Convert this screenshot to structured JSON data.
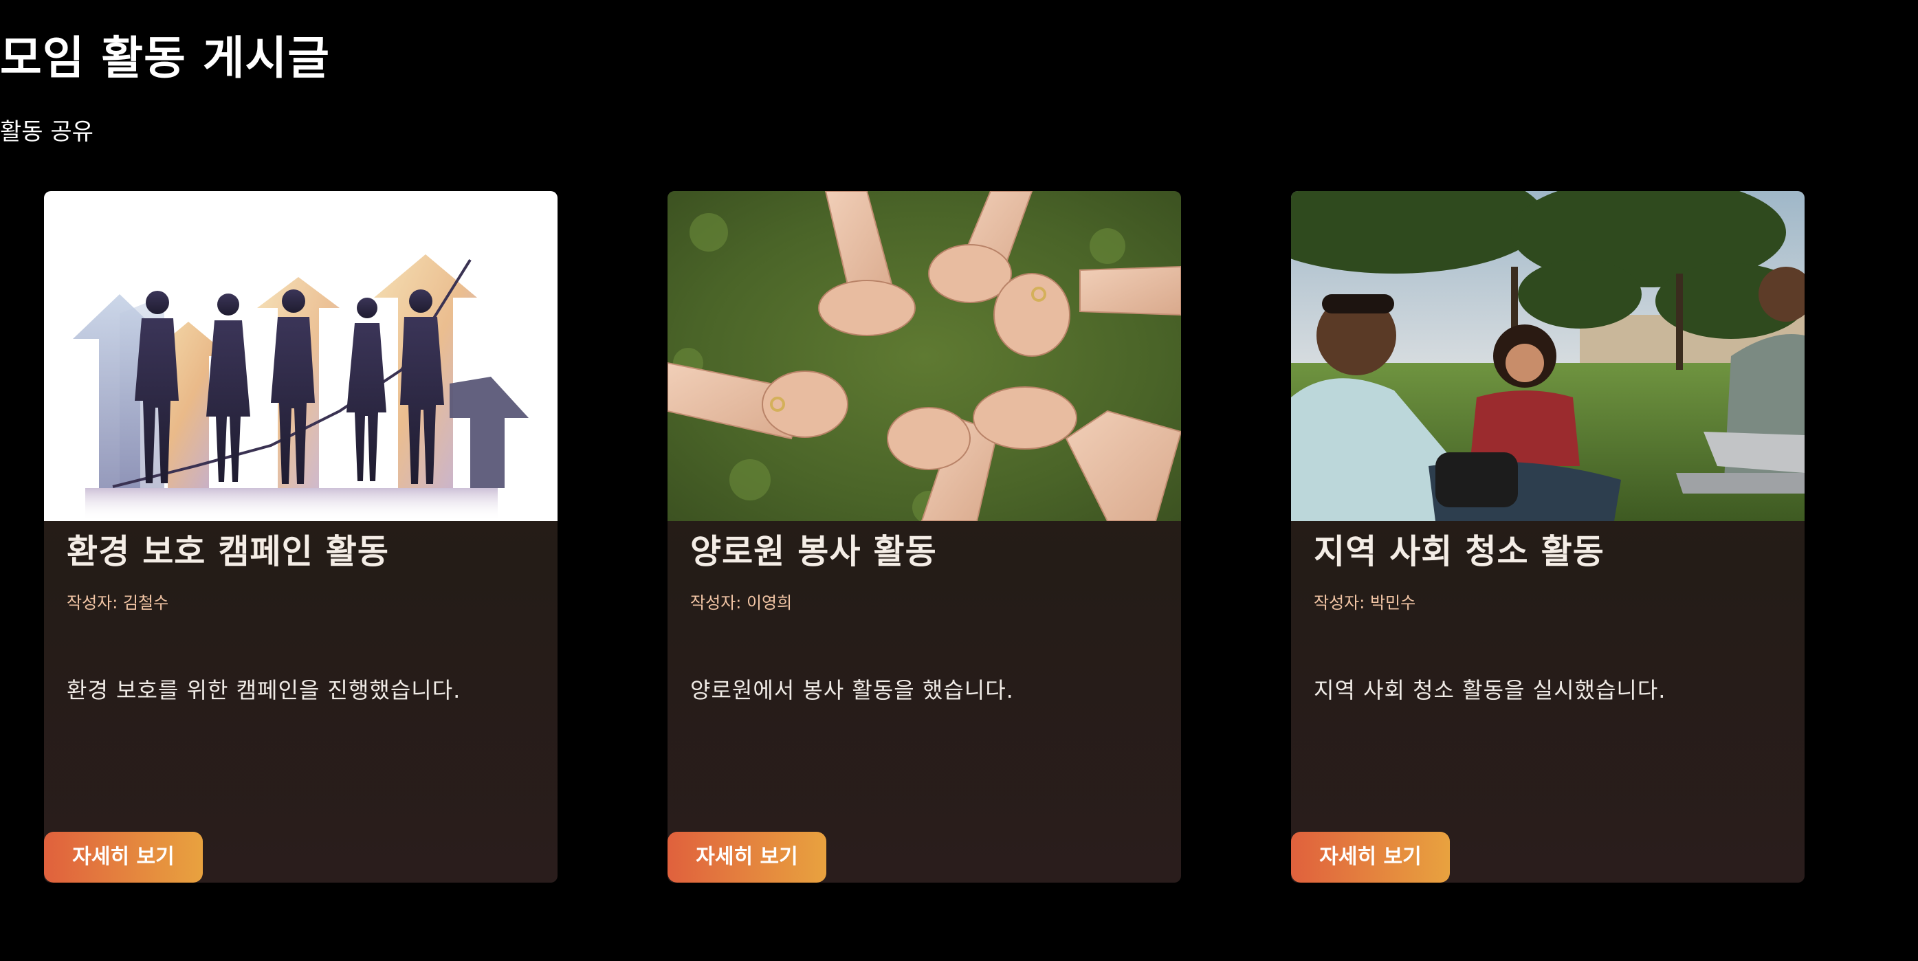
{
  "page": {
    "title": "모임 활동 게시글",
    "subtitle": "활동 공유"
  },
  "cards": [
    {
      "title": "환경 보호 캠페인 활동",
      "author": "작성자: 김철수",
      "description": "환경 보호를 위한 캠페인을 진행했습니다.",
      "button_label": "자세히 보기",
      "image": "silhouettes-of-people-with-rising-arrows"
    },
    {
      "title": "양로원 봉사 활동",
      "author": "작성자: 이영희",
      "description": "양로원에서 봉사 활동을 했습니다.",
      "button_label": "자세히 보기",
      "image": "interlocked-hands-over-grass"
    },
    {
      "title": "지역 사회 청소 활동",
      "author": "작성자: 박민수",
      "description": "지역 사회 청소 활동을 실시했습니다.",
      "button_label": "자세히 보기",
      "image": "students-sitting-on-grass-with-laptop"
    }
  ],
  "colors": {
    "background": "#000000",
    "card_background": "#261d18",
    "button_gradient_start": "#e0613d",
    "button_gradient_end": "#e8a23f",
    "author_text": "#f2c5a5"
  }
}
